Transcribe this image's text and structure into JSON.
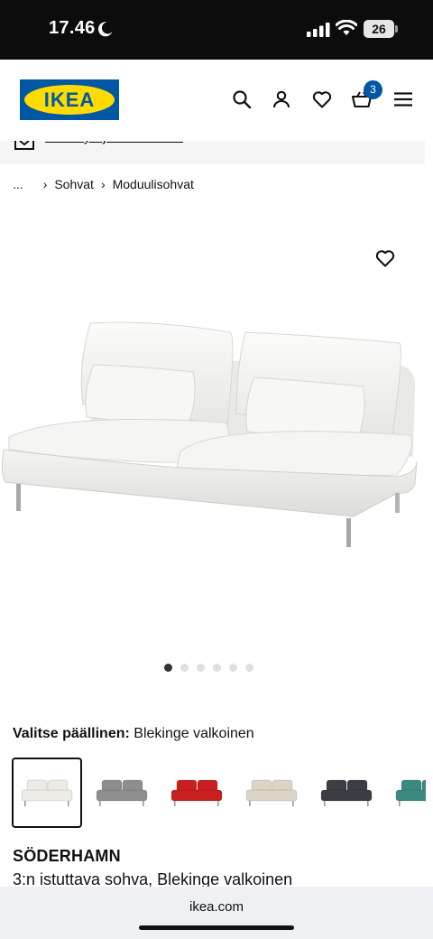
{
  "status_bar": {
    "time": "17.46",
    "battery": "26"
  },
  "header": {
    "logo_text": "IKEA",
    "cart_count": "3"
  },
  "promo": {
    "text": "Tee löytöjä Outletista!"
  },
  "breadcrumb": {
    "ellipsis": "...",
    "items": [
      "Sohvat",
      "Moduulisohvat"
    ]
  },
  "carousel": {
    "total": 6,
    "active_index": 0
  },
  "cover": {
    "label": "Valitse päällinen:",
    "selected": "Blekinge valkoinen",
    "swatch_colors": [
      "#ecebe6",
      "#8e8e8e",
      "#c8201f",
      "#dcd4c6",
      "#3c3e44",
      "#3a8a82"
    ]
  },
  "product": {
    "name": "SÖDERHAMN",
    "description": "3:n istuttava sohva, Blekinge valkoinen"
  },
  "browser": {
    "url": "ikea.com"
  },
  "colors": {
    "ikea_blue": "#0058a3",
    "ikea_yellow": "#ffdb00"
  }
}
